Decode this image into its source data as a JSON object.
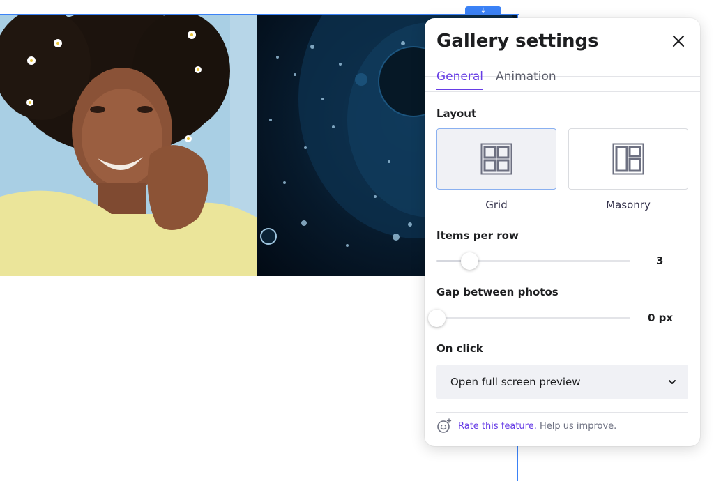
{
  "panel": {
    "title": "Gallery settings",
    "tabs": [
      {
        "label": "General",
        "active": true
      },
      {
        "label": "Animation",
        "active": false
      }
    ],
    "layout": {
      "label": "Layout",
      "options": [
        {
          "label": "Grid",
          "selected": true
        },
        {
          "label": "Masonry",
          "selected": false
        }
      ]
    },
    "items_per_row": {
      "label": "Items per row",
      "value": "3",
      "position_fraction": 0.17
    },
    "gap": {
      "label": "Gap between photos",
      "value": "0 px",
      "position_fraction": 0.0
    },
    "on_click": {
      "label": "On click",
      "selected": "Open full screen preview"
    },
    "footer": {
      "link": "Rate this feature.",
      "text": " Help us improve."
    }
  },
  "colors": {
    "accent": "#673de6",
    "selection_blue": "#3b82f6"
  },
  "icons": [
    "arrow-down-icon",
    "close-icon",
    "grid-layout-icon",
    "masonry-layout-icon",
    "chevron-down-icon",
    "smiley-sparkle-icon"
  ]
}
